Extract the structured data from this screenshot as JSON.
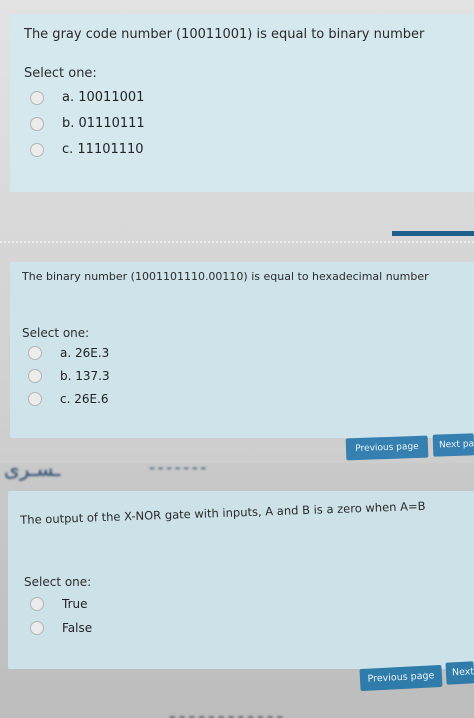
{
  "q1": {
    "question": "The gray code number (10011001) is equal to binary number",
    "select_label": "Select one:",
    "options": [
      "a. 10011001",
      "b. 01110111",
      "c. 11101110"
    ]
  },
  "q2": {
    "question": "The binary number (1001101110.00110) is equal to hexadecimal number",
    "select_label": "Select one:",
    "options": [
      "a. 26E.3",
      "b. 137.3",
      "c. 26E.6"
    ],
    "previous_label": "Previous page",
    "next_label": "Next pa"
  },
  "q3": {
    "question": "The output of the X-NOR gate with inputs, A and B is a zero when A=B",
    "select_label": "Select one:",
    "options": [
      "True",
      "False"
    ],
    "previous_label": "Previous page",
    "next_label": "Next"
  },
  "colors": {
    "card": "#d4e8ed",
    "button": "#2f7cab",
    "background": "#cfcfcf"
  }
}
